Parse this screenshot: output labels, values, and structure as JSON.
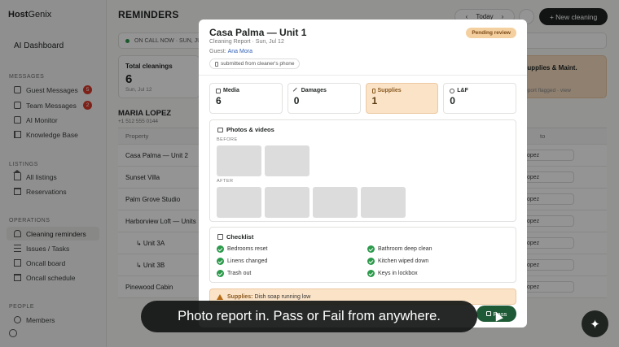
{
  "app": {
    "brand_prefix": "Host",
    "brand_suffix": "Genix",
    "dashboard_title": "AI Dashboard"
  },
  "sidebar": {
    "groups": [
      {
        "label": "MESSAGES"
      },
      {
        "label": "LISTINGS"
      },
      {
        "label": "OPERATIONS"
      },
      {
        "label": "PEOPLE"
      }
    ],
    "items": [
      {
        "label": "Guest Messages",
        "icon": "chat-bubble-icon",
        "badge": "5"
      },
      {
        "label": "Team Messages",
        "icon": "team-chat-icon",
        "badge": "2"
      },
      {
        "label": "AI Monitor",
        "icon": "robot-icon"
      },
      {
        "label": "Knowledge Base",
        "icon": "book-icon"
      },
      {
        "label": "All listings",
        "icon": "house-icon"
      },
      {
        "label": "Reservations",
        "icon": "calendar-icon"
      },
      {
        "label": "Cleaning reminders",
        "icon": "bell-icon",
        "active": true
      },
      {
        "label": "Issues / Tasks",
        "icon": "list-icon"
      },
      {
        "label": "Oncall board",
        "icon": "grid-icon"
      },
      {
        "label": "Oncall schedule",
        "icon": "calendar-icon"
      },
      {
        "label": "Members",
        "icon": "people-icon"
      }
    ]
  },
  "main": {
    "title": "REMINDERS",
    "date_label": "Today",
    "new_button": "+ New cleaning",
    "oncall_text": "ON CALL NOW · SUN, JUL",
    "stat_total_label": "Total cleanings",
    "stat_total_value": "6",
    "stat_total_sub": "Sun, Jul 12",
    "stat_supplies_label": "Supplies & Maint.",
    "stat_supplies_sub": "report flagged · view",
    "person_name": "MARIA LOPEZ",
    "person_phone": "+1 512 555 0144",
    "table_header_property": "Property",
    "table_header_assign": "to",
    "rows": [
      {
        "property": "Casa Palma — Unit 2",
        "assignee": "opez"
      },
      {
        "property": "Sunset Villa",
        "assignee": "opez"
      },
      {
        "property": "Palm Grove Studio",
        "assignee": "opez"
      },
      {
        "property": "Harborview Loft — Units",
        "assignee": "opez"
      },
      {
        "property": "↳ Unit 3A",
        "assignee": "opez"
      },
      {
        "property": "↳ Unit 3B",
        "assignee": "opez"
      },
      {
        "property": "Pinewood Cabin",
        "assignee": "opez"
      }
    ]
  },
  "modal": {
    "title": "Casa Palma — Unit 1",
    "subtitle": "Cleaning Report · Sun, Jul 12",
    "guest_label": "Guest:",
    "guest_name": "Ana Mora",
    "source_chip": "submitted from cleaner's phone",
    "status": "Pending review",
    "stats": [
      {
        "label": "Media",
        "value": "6",
        "icon": "photo-icon"
      },
      {
        "label": "Damages",
        "value": "0",
        "icon": "wrench-icon"
      },
      {
        "label": "Supplies",
        "value": "1",
        "icon": "spray-bottle-icon",
        "highlight": true
      },
      {
        "label": "L&F",
        "value": "0",
        "icon": "search-icon"
      }
    ],
    "photos_title": "Photos & videos",
    "before_label": "BEFORE",
    "after_label": "AFTER",
    "before_count": 2,
    "after_count": 4,
    "checklist_title": "Checklist",
    "checklist": [
      {
        "label": "Bedrooms reset",
        "done": true
      },
      {
        "label": "Bathroom deep clean",
        "done": true
      },
      {
        "label": "Linens changed",
        "done": true
      },
      {
        "label": "Kitchen wiped down",
        "done": true
      },
      {
        "label": "Trash out",
        "done": true
      },
      {
        "label": "Keys in lockbox",
        "done": true
      }
    ],
    "alert_label": "Supplies:",
    "alert_text": "Dish soap running low",
    "pass_button": "Pass"
  },
  "caption": "Photo report in. Pass or Fail from anywhere.",
  "colors": {
    "accent_green": "#1e5a35",
    "pending_bg": "#f4cf9f",
    "supplies_bg": "#fbe3c7",
    "badge_red": "#d93b2b"
  }
}
